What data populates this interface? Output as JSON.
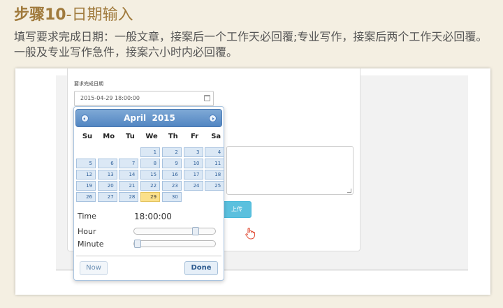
{
  "header": {
    "step_label": "步骤10",
    "separator": "-",
    "step_name": "日期输入",
    "description": "填写要求完成日期：一般文章，接案后一个工作天必回覆;专业写作，接案后两个工作天必回覆。一般及专业写作急件，接案六小时内必回覆。"
  },
  "form": {
    "date_label": "要求完成日期",
    "date_value": "2015-04-29 18:00:00",
    "upload_label": "上传"
  },
  "picker": {
    "month_title": "April  2015",
    "weekdays": [
      "Su",
      "Mo",
      "Tu",
      "We",
      "Th",
      "Fr",
      "Sa"
    ],
    "days": [
      1,
      2,
      3,
      4,
      5,
      6,
      7,
      8,
      9,
      10,
      11,
      12,
      13,
      14,
      15,
      16,
      17,
      18,
      19,
      20,
      21,
      22,
      23,
      24,
      25,
      26,
      27,
      28,
      29,
      30
    ],
    "first_weekday": 3,
    "selected_day": 29,
    "time_label": "Time",
    "time_value": "18:00:00",
    "hour_label": "Hour",
    "minute_label": "Minute",
    "hour_level": 0.78,
    "minute_level": 0.0,
    "now_label": "Now",
    "done_label": "Done"
  },
  "colors": {
    "accent": "#a07a3c",
    "header_blue": "#5286c2",
    "today_yellow": "#fbe08a"
  }
}
